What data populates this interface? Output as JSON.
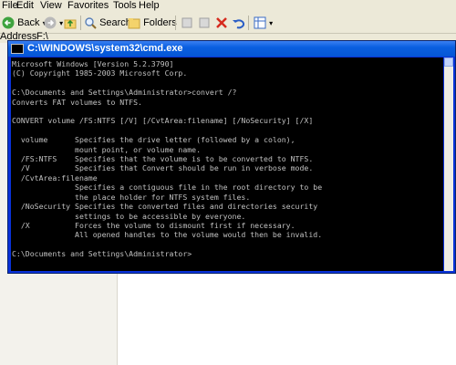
{
  "menubar": {
    "items": [
      "File",
      "Edit",
      "View",
      "Favorites",
      "Tools",
      "Help"
    ]
  },
  "toolbar": {
    "back_label": "Back",
    "search_label": "Search",
    "folders_label": "Folders"
  },
  "addressbar": {
    "label": "Address",
    "value": "F:\\"
  },
  "cmd": {
    "title": "C:\\WINDOWS\\system32\\cmd.exe",
    "lines": [
      "Microsoft Windows [Version 5.2.3790]",
      "(C) Copyright 1985-2003 Microsoft Corp.",
      "",
      "C:\\Documents and Settings\\Administrator>convert /?",
      "Converts FAT volumes to NTFS.",
      "",
      "CONVERT volume /FS:NTFS [/V] [/CvtArea:filename] [/NoSecurity] [/X]",
      "",
      "  volume      Specifies the drive letter (followed by a colon),",
      "              mount point, or volume name.",
      "  /FS:NTFS    Specifies that the volume is to be converted to NTFS.",
      "  /V          Specifies that Convert should be run in verbose mode.",
      "  /CvtArea:filename",
      "              Specifies a contiguous file in the root directory to be",
      "              the place holder for NTFS system files.",
      "  /NoSecurity Specifies the converted files and directories security",
      "              settings to be accessible by everyone.",
      "  /X          Forces the volume to dismount first if necessary.",
      "              All opened handles to the volume would then be invalid.",
      "",
      "C:\\Documents and Settings\\Administrator>"
    ]
  }
}
